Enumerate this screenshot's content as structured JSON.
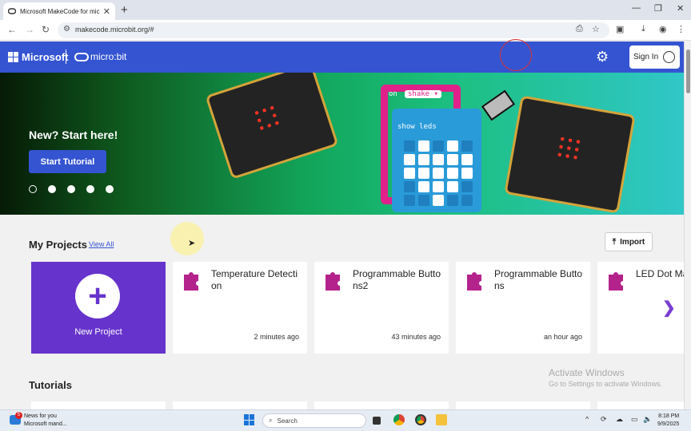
{
  "browser": {
    "tab_title": "Microsoft MakeCode for micro:",
    "tab_close": "✕",
    "new_tab": "+",
    "url": "makecode.microbit.org/#",
    "window_controls": [
      "—",
      "❐",
      "✕"
    ]
  },
  "header": {
    "brand": "Microsoft",
    "product": "micro:bit",
    "signin_label": "Sign In"
  },
  "hero": {
    "headline": "New? Start here!",
    "cta_label": "Start Tutorial",
    "slides": 5,
    "active_slide": 1,
    "block_on": "on",
    "block_event": "shake ▾",
    "block_show": "show leds"
  },
  "projects": {
    "section_title": "My Projects",
    "view_all": "View All",
    "import_label": "Import",
    "new_project_label": "New Project",
    "items": [
      {
        "title": "Temperature Detection",
        "time": "2 minutes ago"
      },
      {
        "title": "Programmable Buttons2",
        "time": "43 minutes ago"
      },
      {
        "title": "Programmable Buttons",
        "time": "an hour ago"
      },
      {
        "title": "LED Dot Ma",
        "time": ""
      }
    ]
  },
  "tutorials": {
    "section_title": "Tutorials"
  },
  "watermark": {
    "line1": "Activate Windows",
    "line2": "Go to Settings to activate Windows."
  },
  "taskbar": {
    "news_badge": "5",
    "news_title": "News for you",
    "news_sub": "Microsoft mand...",
    "search_placeholder": "Search",
    "time": "8:18 PM",
    "date": "9/9/2025"
  },
  "colors": {
    "brand_blue": "#3454d1",
    "new_project_purple": "#6633cc",
    "puzzle_magenta": "#b4238c"
  }
}
